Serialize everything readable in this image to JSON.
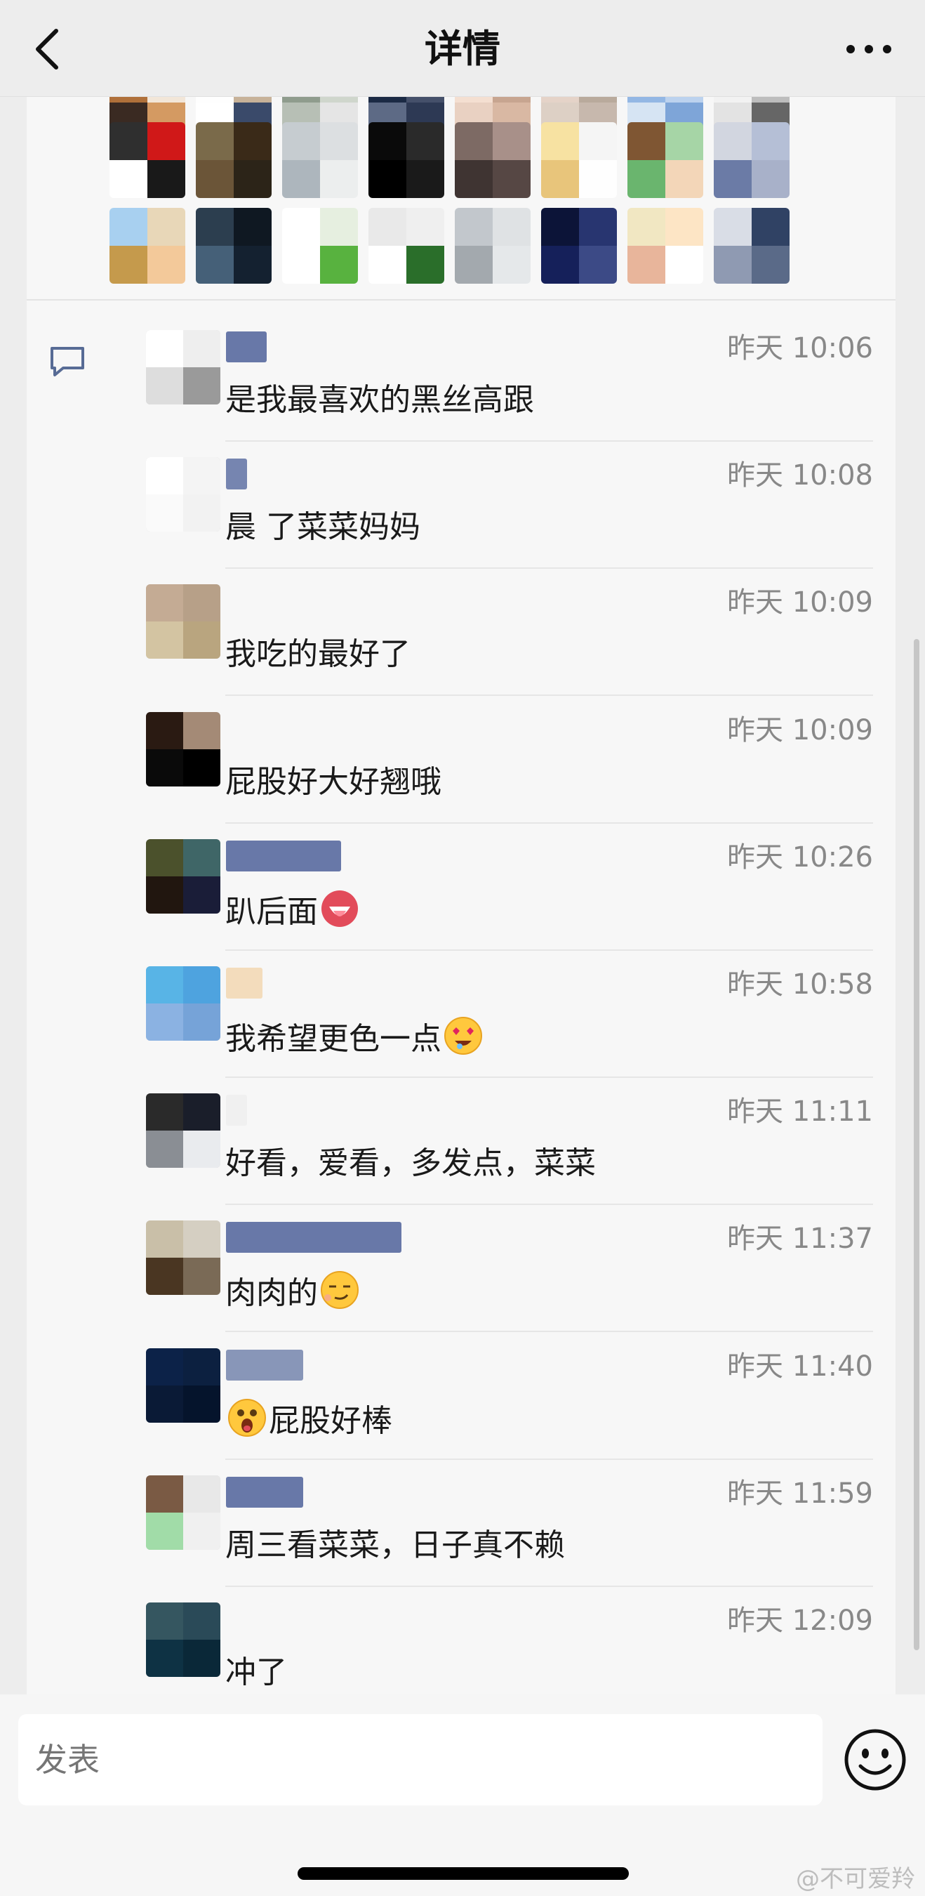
{
  "header": {
    "title": "详情",
    "back_icon": "chevron-left-icon",
    "more_icon": "more-dots-icon"
  },
  "likes": {
    "rows": [
      [
        [
          "#b0703a",
          "#d49a62",
          "#3a2a22",
          "#f2e6d8"
        ],
        [
          "#fefefe",
          "#3a4a6a",
          "#ffffff",
          "#c7b299"
        ],
        [
          "#8f9c8d",
          "#e5e5e5",
          "#b7bfb5",
          "#cfd6cc"
        ],
        [
          "#1b2a44",
          "#2d3954",
          "#5d6a85",
          "#45506a"
        ],
        [
          "#f4dfd1",
          "#d9b8a3",
          "#e9d1c2",
          "#c7a590"
        ],
        [
          "#e5d3c8",
          "#c7b8ad",
          "#ddd0c5",
          "#b9aa9c"
        ],
        [
          "#93b7e4",
          "#7ea5d8",
          "#d6e4f3",
          "#bcd2ee"
        ],
        [
          "#f2f2f2",
          "#666666",
          "#e3e3e3",
          "#bdbdbd"
        ]
      ],
      [
        [
          "#2f2f2f",
          "#191919",
          "#ffffff",
          "#d01818"
        ],
        [
          "#7a6a4a",
          "#2c2418",
          "#6b5538",
          "#3a2a18"
        ],
        [
          "#c6ccd0",
          "#eceeee",
          "#adb6bd",
          "#dcdfe1"
        ],
        [
          "#0a0a0a",
          "#1a1a1a",
          "#000000",
          "#2a2a2a"
        ],
        [
          "#7d6a64",
          "#564744",
          "#3f3432",
          "#a89089"
        ],
        [
          "#f7e2a2",
          "#fefefe",
          "#e8c57b",
          "#f5f5f5"
        ],
        [
          "#7f5633",
          "#f3d6b8",
          "#6ab56e",
          "#a6d5a6"
        ],
        [
          "#d2d6e0",
          "#a8b1c9",
          "#6b7ba6",
          "#b5bfd6"
        ]
      ],
      [
        [
          "#a8d0f0",
          "#f3c99a",
          "#c59a4c",
          "#e8d7b8"
        ],
        [
          "#2c3e4f",
          "#142130",
          "#456078",
          "#0f1822"
        ],
        [
          "#ffffff",
          "#58b23f",
          "#ffffff",
          "#e6efe0"
        ],
        [
          "#e9e9e9",
          "#2a6e2a",
          "#ffffff",
          "#efefef"
        ],
        [
          "#c2c7cc",
          "#e5e8ea",
          "#a3a9ae",
          "#dfe2e4"
        ],
        [
          "#0c1438",
          "#3c4a86",
          "#15205a",
          "#283570"
        ],
        [
          "#f1e7c2",
          "#ffffff",
          "#e8b59b",
          "#fde5c5"
        ],
        [
          "#d9dde6",
          "#5a6a88",
          "#8f9ab2",
          "#304264"
        ]
      ]
    ]
  },
  "comments": [
    {
      "time": "昨天 10:06",
      "text": "是我最喜欢的黑丝高跟",
      "emoji_before": "",
      "emoji_after": "",
      "avatar": [
        "#ffffff",
        "#eeeeee",
        "#dddddd",
        "#9a9a9a"
      ],
      "nick_color": "#6878a8",
      "nick_width": 58
    },
    {
      "time": "昨天 10:08",
      "text": "晨 了菜菜妈妈",
      "emoji_before": "",
      "emoji_after": "",
      "avatar": [
        "#ffffff",
        "#f4f4f4",
        "#fafafa",
        "#f2f2f2"
      ],
      "nick_color": "#7685b0",
      "nick_width": 30
    },
    {
      "time": "昨天 10:09",
      "text": "我吃的最好了",
      "emoji_before": "",
      "emoji_after": "",
      "avatar": [
        "#c4ab94",
        "#b7a088",
        "#d3c4a2",
        "#b9a57f"
      ],
      "nick_color": "#f7f7f7",
      "nick_width": 0
    },
    {
      "time": "昨天 10:09",
      "text": "屁股好大好翘哦",
      "emoji_before": "",
      "emoji_after": "",
      "avatar": [
        "#2a1a12",
        "#a48a76",
        "#0a0a0a",
        "#000000"
      ],
      "nick_color": "#f7f7f7",
      "nick_width": 0
    },
    {
      "time": "昨天 10:26",
      "text": "趴后面",
      "emoji_before": "",
      "emoji_after": "tongue-face-emoji",
      "avatar": [
        "#4b512c",
        "#3f6667",
        "#21160f",
        "#1a1d38"
      ],
      "nick_color": "#6878a8",
      "nick_width": 164
    },
    {
      "time": "昨天 10:58",
      "text": "我希望更色一点",
      "emoji_before": "",
      "emoji_after": "heart-eyes-emoji",
      "avatar": [
        "#58b4e6",
        "#4ea3df",
        "#8bb2e2",
        "#76a3d8"
      ],
      "nick_color": "#f3dcbc",
      "nick_width": 52
    },
    {
      "time": "昨天 11:11",
      "text": "好看，爱看，多发点，菜菜",
      "emoji_before": "",
      "emoji_after": "",
      "avatar": [
        "#2a2a2a",
        "#1a1e2a",
        "#8a8e94",
        "#e9ebee"
      ],
      "nick_color": "#f0f0f0",
      "nick_width": 30
    },
    {
      "time": "昨天 11:37",
      "text": "肉肉的",
      "emoji_before": "",
      "emoji_after": "smug-face-emoji",
      "avatar": [
        "#c9bfa8",
        "#d5cfc2",
        "#4a3622",
        "#7a6a56"
      ],
      "nick_color": "#6878a8",
      "nick_width": 250
    },
    {
      "time": "昨天 11:40",
      "text": "屁股好棒",
      "emoji_before": "surprised-face-emoji",
      "emoji_after": "",
      "avatar": [
        "#0c2248",
        "#0c2040",
        "#0a1a36",
        "#05142c"
      ],
      "nick_color": "#8896b8",
      "nick_width": 110
    },
    {
      "time": "昨天 11:59",
      "text": "周三看菜菜，日子真不赖",
      "emoji_before": "",
      "emoji_after": "",
      "avatar": [
        "#7a5a44",
        "#e8e8e8",
        "#a1dca8",
        "#f0f0f0"
      ],
      "nick_color": "#6878a8",
      "nick_width": 110
    },
    {
      "time": "昨天 12:09",
      "text": "冲了",
      "emoji_before": "",
      "emoji_after": "",
      "avatar": [
        "#355660",
        "#2a4a58",
        "#0e3244",
        "#0a2838"
      ],
      "nick_color": "#f2f2f2",
      "nick_width": 0
    }
  ],
  "input": {
    "placeholder": "发表",
    "emoji_icon": "smiley-face-icon"
  },
  "watermark": "@不可爱羚",
  "colors": {
    "background": "#ededed",
    "card": "#f7f7f7",
    "nickname_blue": "#576b95",
    "time_gray": "#888888"
  }
}
